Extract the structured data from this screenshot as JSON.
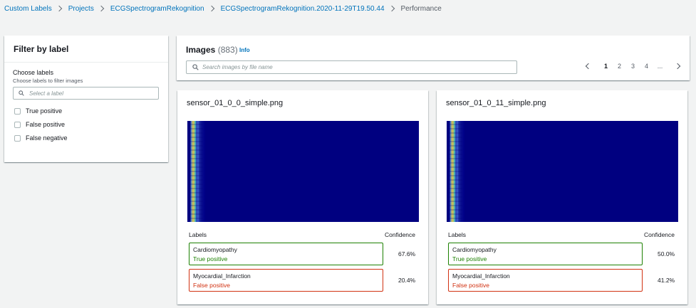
{
  "breadcrumb": {
    "items": [
      "Custom Labels",
      "Projects",
      "ECGSpectrogramRekognition",
      "ECGSpectrogramRekognition.2020-11-29T19.50.44"
    ],
    "current": "Performance"
  },
  "filter": {
    "title": "Filter by label",
    "choose_title": "Choose labels",
    "choose_desc": "Choose labels to filter images",
    "select_placeholder": "Select a label",
    "options": [
      "True positive",
      "False positive",
      "False negative"
    ]
  },
  "images": {
    "title": "Images",
    "count": "(883)",
    "info": "Info",
    "search_placeholder": "Search images by file name",
    "pages": [
      "1",
      "2",
      "3",
      "4",
      "..."
    ]
  },
  "cards": [
    {
      "filename": "sensor_01_0_0_simple.png",
      "labels_header": "Labels",
      "confidence_header": "Confidence",
      "labels": [
        {
          "name": "Cardiomyopathy",
          "status": "True positive",
          "confidence": "67.6%"
        },
        {
          "name": "Myocardial_Infarction",
          "status": "False positive",
          "confidence": "20.4%"
        }
      ]
    },
    {
      "filename": "sensor_01_0_11_simple.png",
      "labels_header": "Labels",
      "confidence_header": "Confidence",
      "labels": [
        {
          "name": "Cardiomyopathy",
          "status": "True positive",
          "confidence": "50.0%"
        },
        {
          "name": "Myocardial_Infarction",
          "status": "False positive",
          "confidence": "41.2%"
        }
      ]
    }
  ],
  "colors": {
    "link": "#0073bb",
    "true_positive": "#1d8102",
    "false_positive": "#d13212",
    "spectrogram_bg": "#000080"
  }
}
